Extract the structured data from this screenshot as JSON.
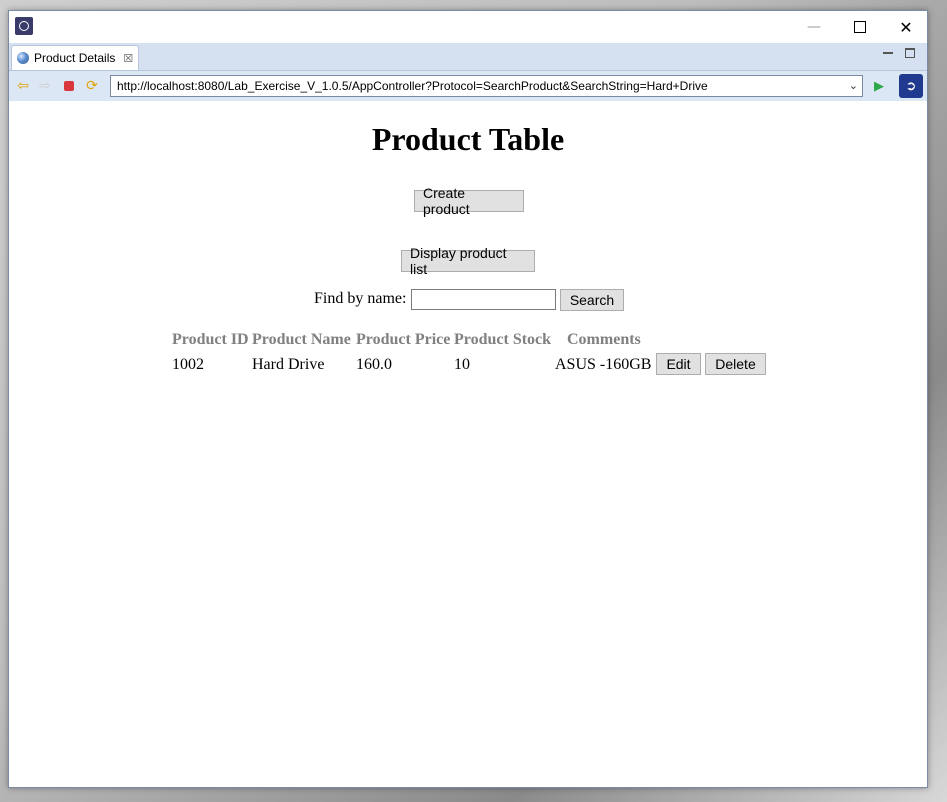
{
  "window": {
    "minimize_glyph": "—",
    "close_glyph": "✕"
  },
  "tab": {
    "label": "Product Details",
    "close_glyph": "☒"
  },
  "navbar": {
    "url": "http://localhost:8080/Lab_Exercise_V_1.0.5/AppController?Protocol=SearchProduct&SearchString=Hard+Drive"
  },
  "page": {
    "title": "Product Table",
    "create_button": "Create product",
    "display_button": "Display product list",
    "find_label": "Find by name:",
    "search_value": "",
    "search_button": "Search"
  },
  "table": {
    "headers": [
      "Product ID",
      "Product Name",
      "Product Price",
      "Product Stock",
      "Comments"
    ],
    "rows": [
      {
        "id": "1002",
        "name": "Hard Drive",
        "price": "160.0",
        "stock": "10",
        "comments": "ASUS -160GB",
        "edit_label": "Edit",
        "delete_label": "Delete"
      }
    ]
  },
  "icons": {
    "app": "eclipse-app-icon",
    "back": "back-arrow-icon",
    "forward": "forward-arrow-icon",
    "stop": "stop-icon",
    "refresh": "refresh-icon",
    "go": "go-play-icon",
    "external": "external-browser-icon"
  },
  "colors": {
    "tab_bar": "#d5e1f1",
    "header_text": "#808080",
    "stop": "#d9363e",
    "go": "#2ea84a"
  }
}
